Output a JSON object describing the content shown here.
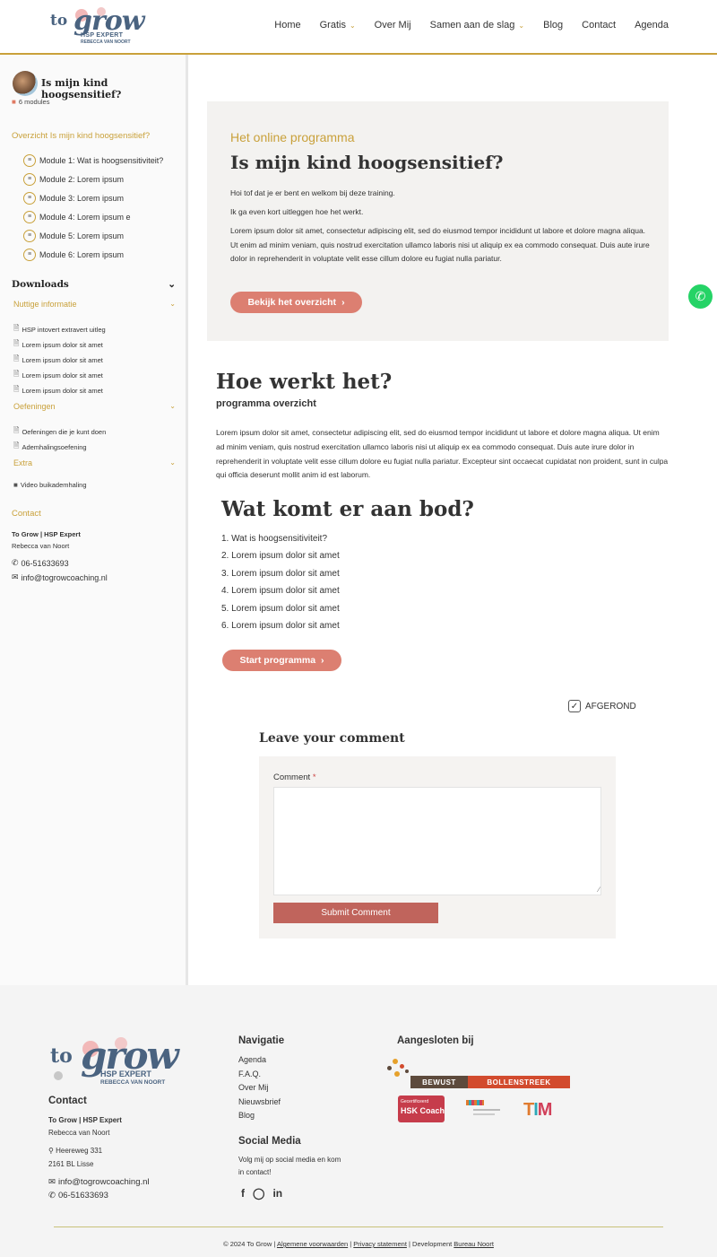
{
  "brand": {
    "logo_small": "to",
    "logo_big": "grow",
    "tagline": "HSP EXPERT",
    "owner": "REBECCA VAN NOORT",
    "colors": {
      "gold": "#c9a13b",
      "rose": "#dc7f71",
      "navy": "#4a6380"
    }
  },
  "nav": {
    "items": [
      {
        "label": "Home",
        "dropdown": false
      },
      {
        "label": "Gratis",
        "dropdown": true
      },
      {
        "label": "Over Mij",
        "dropdown": false
      },
      {
        "label": "Samen aan de slag",
        "dropdown": true
      },
      {
        "label": "Blog",
        "dropdown": false
      },
      {
        "label": "Contact",
        "dropdown": false
      },
      {
        "label": "Agenda",
        "dropdown": false
      }
    ]
  },
  "sidebar": {
    "course_title": "Is mijn kind hoogsensitief?",
    "modules_count": "6 modules",
    "overview_link": "Overzicht Is mijn kind hoogsensitief?",
    "modules": [
      "Module 1: Wat is hoogsensitiviteit?",
      "Module 2: Lorem ipsum",
      "Module 3: Lorem ipsum",
      "Module 4: Lorem ipsum e",
      "Module 5: Lorem ipsum",
      "Module 6: Lorem ipsum"
    ],
    "downloads_heading": "Downloads",
    "categories": [
      {
        "label": "Nuttige informatie",
        "files": [
          "HSP intovert extravert uitleg",
          "Lorem ipsum dolor sit amet",
          "Lorem ipsum dolor sit amet",
          "Lorem ipsum dolor sit amet",
          "Lorem ipsum dolor sit amet"
        ]
      },
      {
        "label": "Oefeningen",
        "files": [
          "Oefeningen die je kunt doen",
          "Ademhalingsoefening"
        ]
      },
      {
        "label": "Extra",
        "files": [
          "Video buikademhaling"
        ]
      }
    ],
    "contact": {
      "heading": "Contact",
      "company": "To Grow | HSP Expert",
      "name": "Rebecca van Noort",
      "phone": "06-51633693",
      "email": "info@togrowcoaching.nl"
    }
  },
  "intro": {
    "subtitle": "Het online programma",
    "title": "Is mijn kind hoogsensitief?",
    "p1": "Hoi tof dat je er bent en welkom bij deze training.",
    "p2": "Ik ga even kort uitleggen hoe het werkt.",
    "p3": "Lorem ipsum dolor sit amet, consectetur adipiscing elit, sed do eiusmod tempor incididunt ut labore et dolore magna aliqua. Ut enim ad minim veniam, quis nostrud exercitation ullamco laboris nisi ut aliquip ex ea commodo consequat. Duis aute irure dolor in reprehenderit in voluptate velit esse cillum dolore eu fugiat nulla pariatur.",
    "button": "Bekijk het overzicht"
  },
  "how": {
    "title": "Hoe werkt het?",
    "subtitle": "programma overzicht",
    "text": "Lorem ipsum dolor sit amet, consectetur adipiscing elit, sed do eiusmod tempor incididunt ut labore et dolore magna aliqua. Ut enim ad minim veniam, quis nostrud exercitation ullamco laboris nisi ut aliquip ex ea commodo consequat. Duis aute irure dolor in reprehenderit in voluptate velit esse cillum dolore eu fugiat nulla pariatur. Excepteur sint occaecat cupidatat non proident, sunt in culpa qui officia deserunt mollit anim id est laborum."
  },
  "offer": {
    "title": "Wat komt er aan bod?",
    "items": [
      "1.  Wat is hoogsensitiviteit?",
      "2.  Lorem ipsum dolor sit amet",
      "3. Lorem ipsum dolor sit amet",
      "4. Lorem ipsum dolor sit amet",
      "5. Lorem ipsum dolor sit amet",
      "6.  Lorem ipsum dolor sit amet"
    ],
    "button": "Start programma"
  },
  "completed_label": "AFGEROND",
  "comment": {
    "heading": "Leave your comment",
    "label": "Comment",
    "required_mark": "*",
    "textarea_value": "",
    "submit": "Submit Comment"
  },
  "footer": {
    "contact_heading": "Contact",
    "company": "To Grow | HSP Expert",
    "name": "Rebecca van Noort",
    "street": "Heereweg 331",
    "city": "2161 BL Lisse",
    "email": "info@togrowcoaching.nl",
    "phone": "06-51633693",
    "nav_heading": "Navigatie",
    "nav_items": [
      "Agenda",
      "F.A.Q.",
      "Over Mij",
      "Nieuwsbrief",
      "Blog"
    ],
    "social_heading": "Social Media",
    "social_text_1": "Volg mij op social media en kom",
    "social_text_2": "in contact!",
    "aff_heading": "Aangesloten bij",
    "bb_left": "BEWUST",
    "bb_right": "BOLLENSTREEK",
    "hsk_top": "Gecertificeerd",
    "hsk_main": "HSK Coach",
    "tim_letters": [
      "T",
      "I",
      "M"
    ],
    "copyright_prefix": "© 2024 To Grow | ",
    "link_terms": "Algemene voorwaarden",
    "sep": " | ",
    "link_privacy": "Privacy statement",
    "dev_prefix": " | Development ",
    "link_dev": "Bureau Noort"
  }
}
